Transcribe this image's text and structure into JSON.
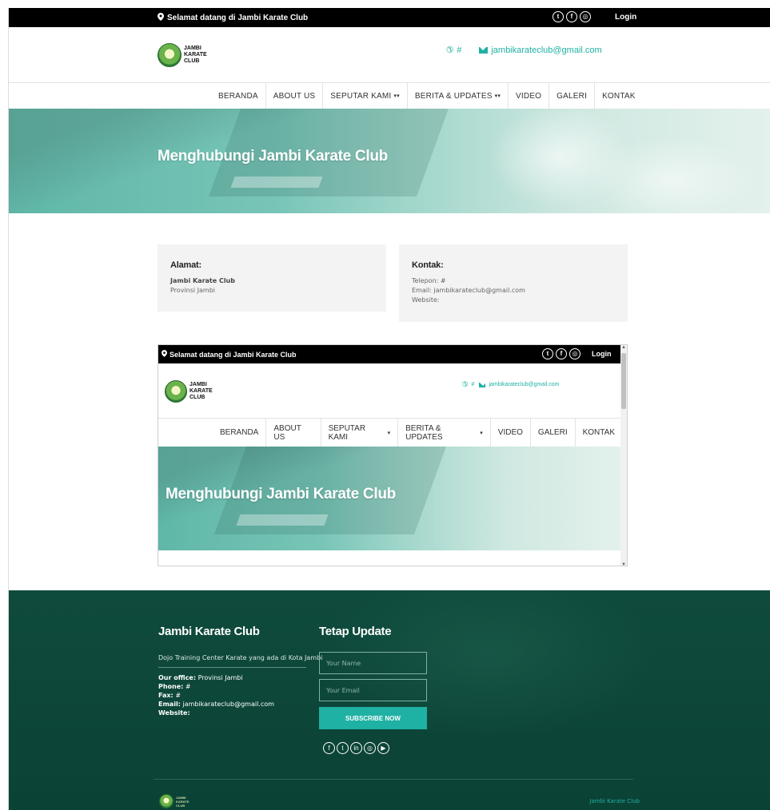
{
  "topbar": {
    "welcome": "Selamat datang di Jambi Karate Club",
    "login": "Login"
  },
  "header": {
    "logo_text": "JAMBI KARATE CLUB",
    "phone": "#",
    "email": "jambikarateclub@gmail.com"
  },
  "nav": {
    "items": [
      "BERANDA",
      "ABOUT US",
      "SEPUTAR KAMI",
      "BERITA & UPDATES",
      "VIDEO",
      "GALERI",
      "KONTAK"
    ]
  },
  "hero": {
    "title": "Menghubungi Jambi Karate Club"
  },
  "alamat": {
    "heading": "Alamat:",
    "line1": "Jambi Karate Club",
    "line2": "Provinsi Jambi"
  },
  "kontak": {
    "heading": "Kontak:",
    "telepon": "Telepon: #",
    "email": "Email: jambikarateclub@gmail.com",
    "website": "Website:"
  },
  "footer": {
    "title": "Jambi Karate Club",
    "description": "Dojo Training Center Karate yang ada di Kota Jambi",
    "office_label": "Our office:",
    "office_value": "Provinsi Jambi",
    "phone_label": "Phone:",
    "phone_value": "#",
    "fax_label": "Fax:",
    "fax_value": "#",
    "email_label": "Email:",
    "email_value": "jambikarateclub@gmail.com",
    "website_label": "Website:",
    "newsletter_title": "Tetap Update",
    "name_placeholder": "Your Name",
    "email_placeholder": "Your Email",
    "subscribe_label": "SUBSCRIBE NOW",
    "copyright": "Jambi Karate Club"
  },
  "colors": {
    "accent": "#1fb1a3",
    "footer_bg": "#0f4b3d",
    "topbar_bg": "#000000"
  }
}
